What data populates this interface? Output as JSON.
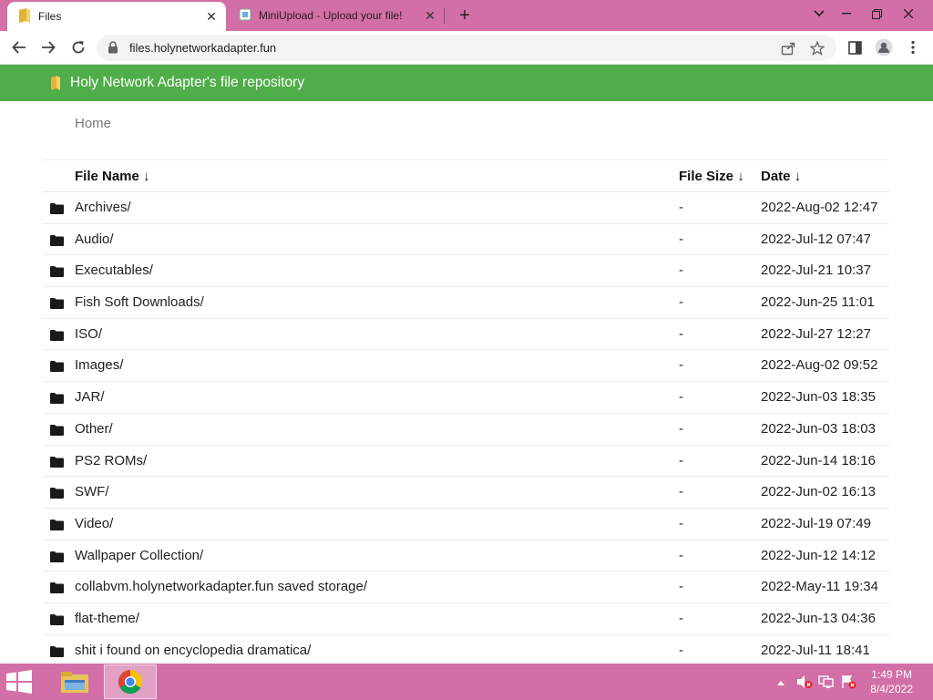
{
  "browser": {
    "tabs": [
      {
        "title": "Files",
        "close": "✕"
      },
      {
        "title": "MiniUpload - Upload your file!",
        "close": "✕"
      }
    ],
    "new_tab": "+",
    "address": "files.holynetworkadapter.fun"
  },
  "page": {
    "header_title": "Holy Network Adapter's file repository",
    "breadcrumb": "Home",
    "columns": {
      "name": "File Name  ↓",
      "size": "File Size  ↓",
      "date": "Date  ↓"
    },
    "rows": [
      {
        "name": "Archives/",
        "size": "-",
        "date": "2022-Aug-02 12:47"
      },
      {
        "name": "Audio/",
        "size": "-",
        "date": "2022-Jul-12 07:47"
      },
      {
        "name": "Executables/",
        "size": "-",
        "date": "2022-Jul-21 10:37"
      },
      {
        "name": "Fish Soft Downloads/",
        "size": "-",
        "date": "2022-Jun-25 11:01"
      },
      {
        "name": "ISO/",
        "size": "-",
        "date": "2022-Jul-27 12:27"
      },
      {
        "name": "Images/",
        "size": "-",
        "date": "2022-Aug-02 09:52"
      },
      {
        "name": "JAR/",
        "size": "-",
        "date": "2022-Jun-03 18:35"
      },
      {
        "name": "Other/",
        "size": "-",
        "date": "2022-Jun-03 18:03"
      },
      {
        "name": "PS2 ROMs/",
        "size": "-",
        "date": "2022-Jun-14 18:16"
      },
      {
        "name": "SWF/",
        "size": "-",
        "date": "2022-Jun-02 16:13"
      },
      {
        "name": "Video/",
        "size": "-",
        "date": "2022-Jul-19 07:49"
      },
      {
        "name": "Wallpaper Collection/",
        "size": "-",
        "date": "2022-Jun-12 14:12"
      },
      {
        "name": "collabvm.holynetworkadapter.fun saved storage/",
        "size": "-",
        "date": "2022-May-11 19:34"
      },
      {
        "name": "flat-theme/",
        "size": "-",
        "date": "2022-Jun-13 04:36"
      },
      {
        "name": "shit i found on encyclopedia dramatica/",
        "size": "-",
        "date": "2022-Jul-11 18:41"
      }
    ]
  },
  "taskbar": {
    "time": "1:49 PM",
    "date": "8/4/2022"
  },
  "colors": {
    "accent_pink": "#d36fa7",
    "header_green": "#4fad4a"
  }
}
